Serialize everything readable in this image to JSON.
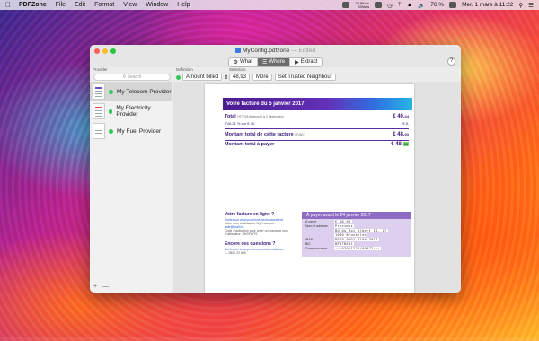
{
  "menubar": {
    "app": "PDFZone",
    "items": [
      "File",
      "Edit",
      "Format",
      "View",
      "Window",
      "Help"
    ],
    "net_up": "25.8Ko/s",
    "net_down": "22Mo/s",
    "battery": "76 %",
    "datetime": "Mer. 1 mars à 11:22"
  },
  "window": {
    "title": "MyConfig.pdfzone",
    "edited": "— Edited",
    "toolbar": {
      "what": "What",
      "where": "Where",
      "extract": "Extract"
    },
    "labels": {
      "provider": "Provider",
      "definition": "Definition",
      "selection": "Selection"
    },
    "search_placeholder": "Search",
    "definition_value": "Amount billed",
    "selection_value": "48,93",
    "more": "More",
    "trusted": "Set Trusted Neighbour",
    "help": "?"
  },
  "sidebar": {
    "providers": [
      "My Telecom Provider",
      "My Electricity Provider",
      "My Fuel Provider"
    ],
    "add": "+",
    "remove": "—"
  },
  "invoice": {
    "banner": "Votre facture du 5 janvier 2017",
    "total_label": "Total",
    "total_sub": "HT/TVA et arrondi à 2 décimales)",
    "total_amt": "€ 40,",
    "total_amt_cents": "44",
    "tva_label": "TVA 21 % sur € 40,",
    "tva_amt": "€ 8,",
    "montant_tvac_label": "Montant total de cette facture",
    "montant_tvac_sub": "(TVAC)",
    "montant_tvac_amt": "€ 48,",
    "montant_tvac_cents": "93",
    "a_payer_label": "Montant total à payer",
    "a_payer_amt": "€ 48,",
    "a_payer_cents": "93",
    "online_h": "Votre facture en ligne ?",
    "online_l1": "Surfez sur www.proximus.be/espaceclient",
    "online_l2": "Votre nom d'utilisateur MyProximus :",
    "online_l3": "jade@mail.be",
    "online_l4": "Code d'activation pour créer un nouveau nom",
    "online_l5": "d'utilisateur : BrGFWT9",
    "questions_h": "Encore des questions ?",
    "questions_l1": "Surfez sur www.proximus.be/aspectfacture",
    "questions_l2": "— 0800 22 800",
    "pay_h": "À payer avant le 24 janvier 2017",
    "pay_rows": [
      {
        "k": "À payer",
        "v": "€ 48,93"
      },
      {
        "k": "Nom et adresse",
        "v": "Proximus"
      },
      {
        "k": "",
        "v": "Bd du Roi Albert II, 27"
      },
      {
        "k": "",
        "v": "1030 Bruxelles"
      },
      {
        "k": "IBAN",
        "v": "BE60 0001 7100 3017"
      },
      {
        "k": "BIC",
        "v": "BPOTBEB1"
      },
      {
        "k": "Communication",
        "v": "+++070/1225/09072+++"
      }
    ]
  }
}
